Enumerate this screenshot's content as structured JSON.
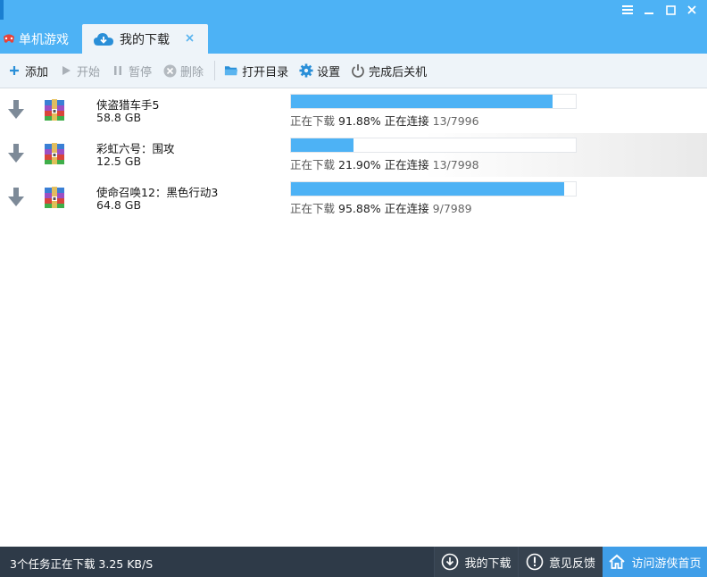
{
  "tabs": {
    "games_label": "单机游戏",
    "downloads_label": "我的下载"
  },
  "toolbar": {
    "add": "添加",
    "start": "开始",
    "pause": "暂停",
    "delete": "删除",
    "open_dir": "打开目录",
    "settings": "设置",
    "shutdown_after": "完成后关机"
  },
  "downloads": [
    {
      "name": "侠盗猎车手5",
      "size": "58.8 GB",
      "status": "正在下载",
      "percent": "91.88%",
      "progress": 0.9188,
      "conn": "正在连接",
      "count": "13/7996"
    },
    {
      "name": "彩虹六号：围攻",
      "size": "12.5 GB",
      "status": "正在下载",
      "percent": "21.90%",
      "progress": 0.219,
      "conn": "正在连接",
      "count": "13/7998"
    },
    {
      "name": "使命召唤12：黑色行动3",
      "size": "64.8 GB",
      "status": "正在下载",
      "percent": "95.88%",
      "progress": 0.9588,
      "conn": "正在连接",
      "count": "9/7989"
    }
  ],
  "footer": {
    "status": "3个任务正在下载 3.25 KB/S",
    "my_downloads": "我的下载",
    "feedback": "意见反馈",
    "visit_home": "访问游侠首页"
  },
  "colors": {
    "accent": "#4db2f5",
    "footer_bg": "#2e3a48",
    "home_btn": "#3f9ee8"
  }
}
